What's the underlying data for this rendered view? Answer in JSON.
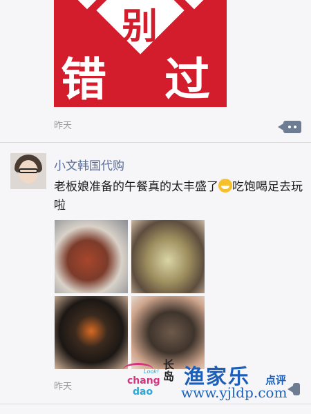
{
  "post1": {
    "banner": {
      "char_top": "别",
      "char_left": "错",
      "char_right": "过"
    },
    "time": "昨天"
  },
  "post2": {
    "username": "小文韩国代购",
    "text_before_emoji": "老板娘准备的午餐真的太丰盛了",
    "emoji": "grinning-face-emoji",
    "text_after_emoji": "吃饱喝足去玩啦",
    "photos": [
      "lobster-photo",
      "abalone-photo",
      "sea-urchin-photo",
      "shellfish-photo"
    ],
    "time": "昨天"
  },
  "watermark": {
    "logo_ch": "chang",
    "logo_dao": "dao",
    "logo_look": "Look!",
    "logo_vertical": "长岛",
    "brand": "渔家乐",
    "brand_sub": "点评",
    "site": "www.yjldp.com"
  },
  "colors": {
    "accent_username": "#576b95",
    "banner_red": "#d31d2c",
    "watermark_blue": "#1d5fb8"
  }
}
